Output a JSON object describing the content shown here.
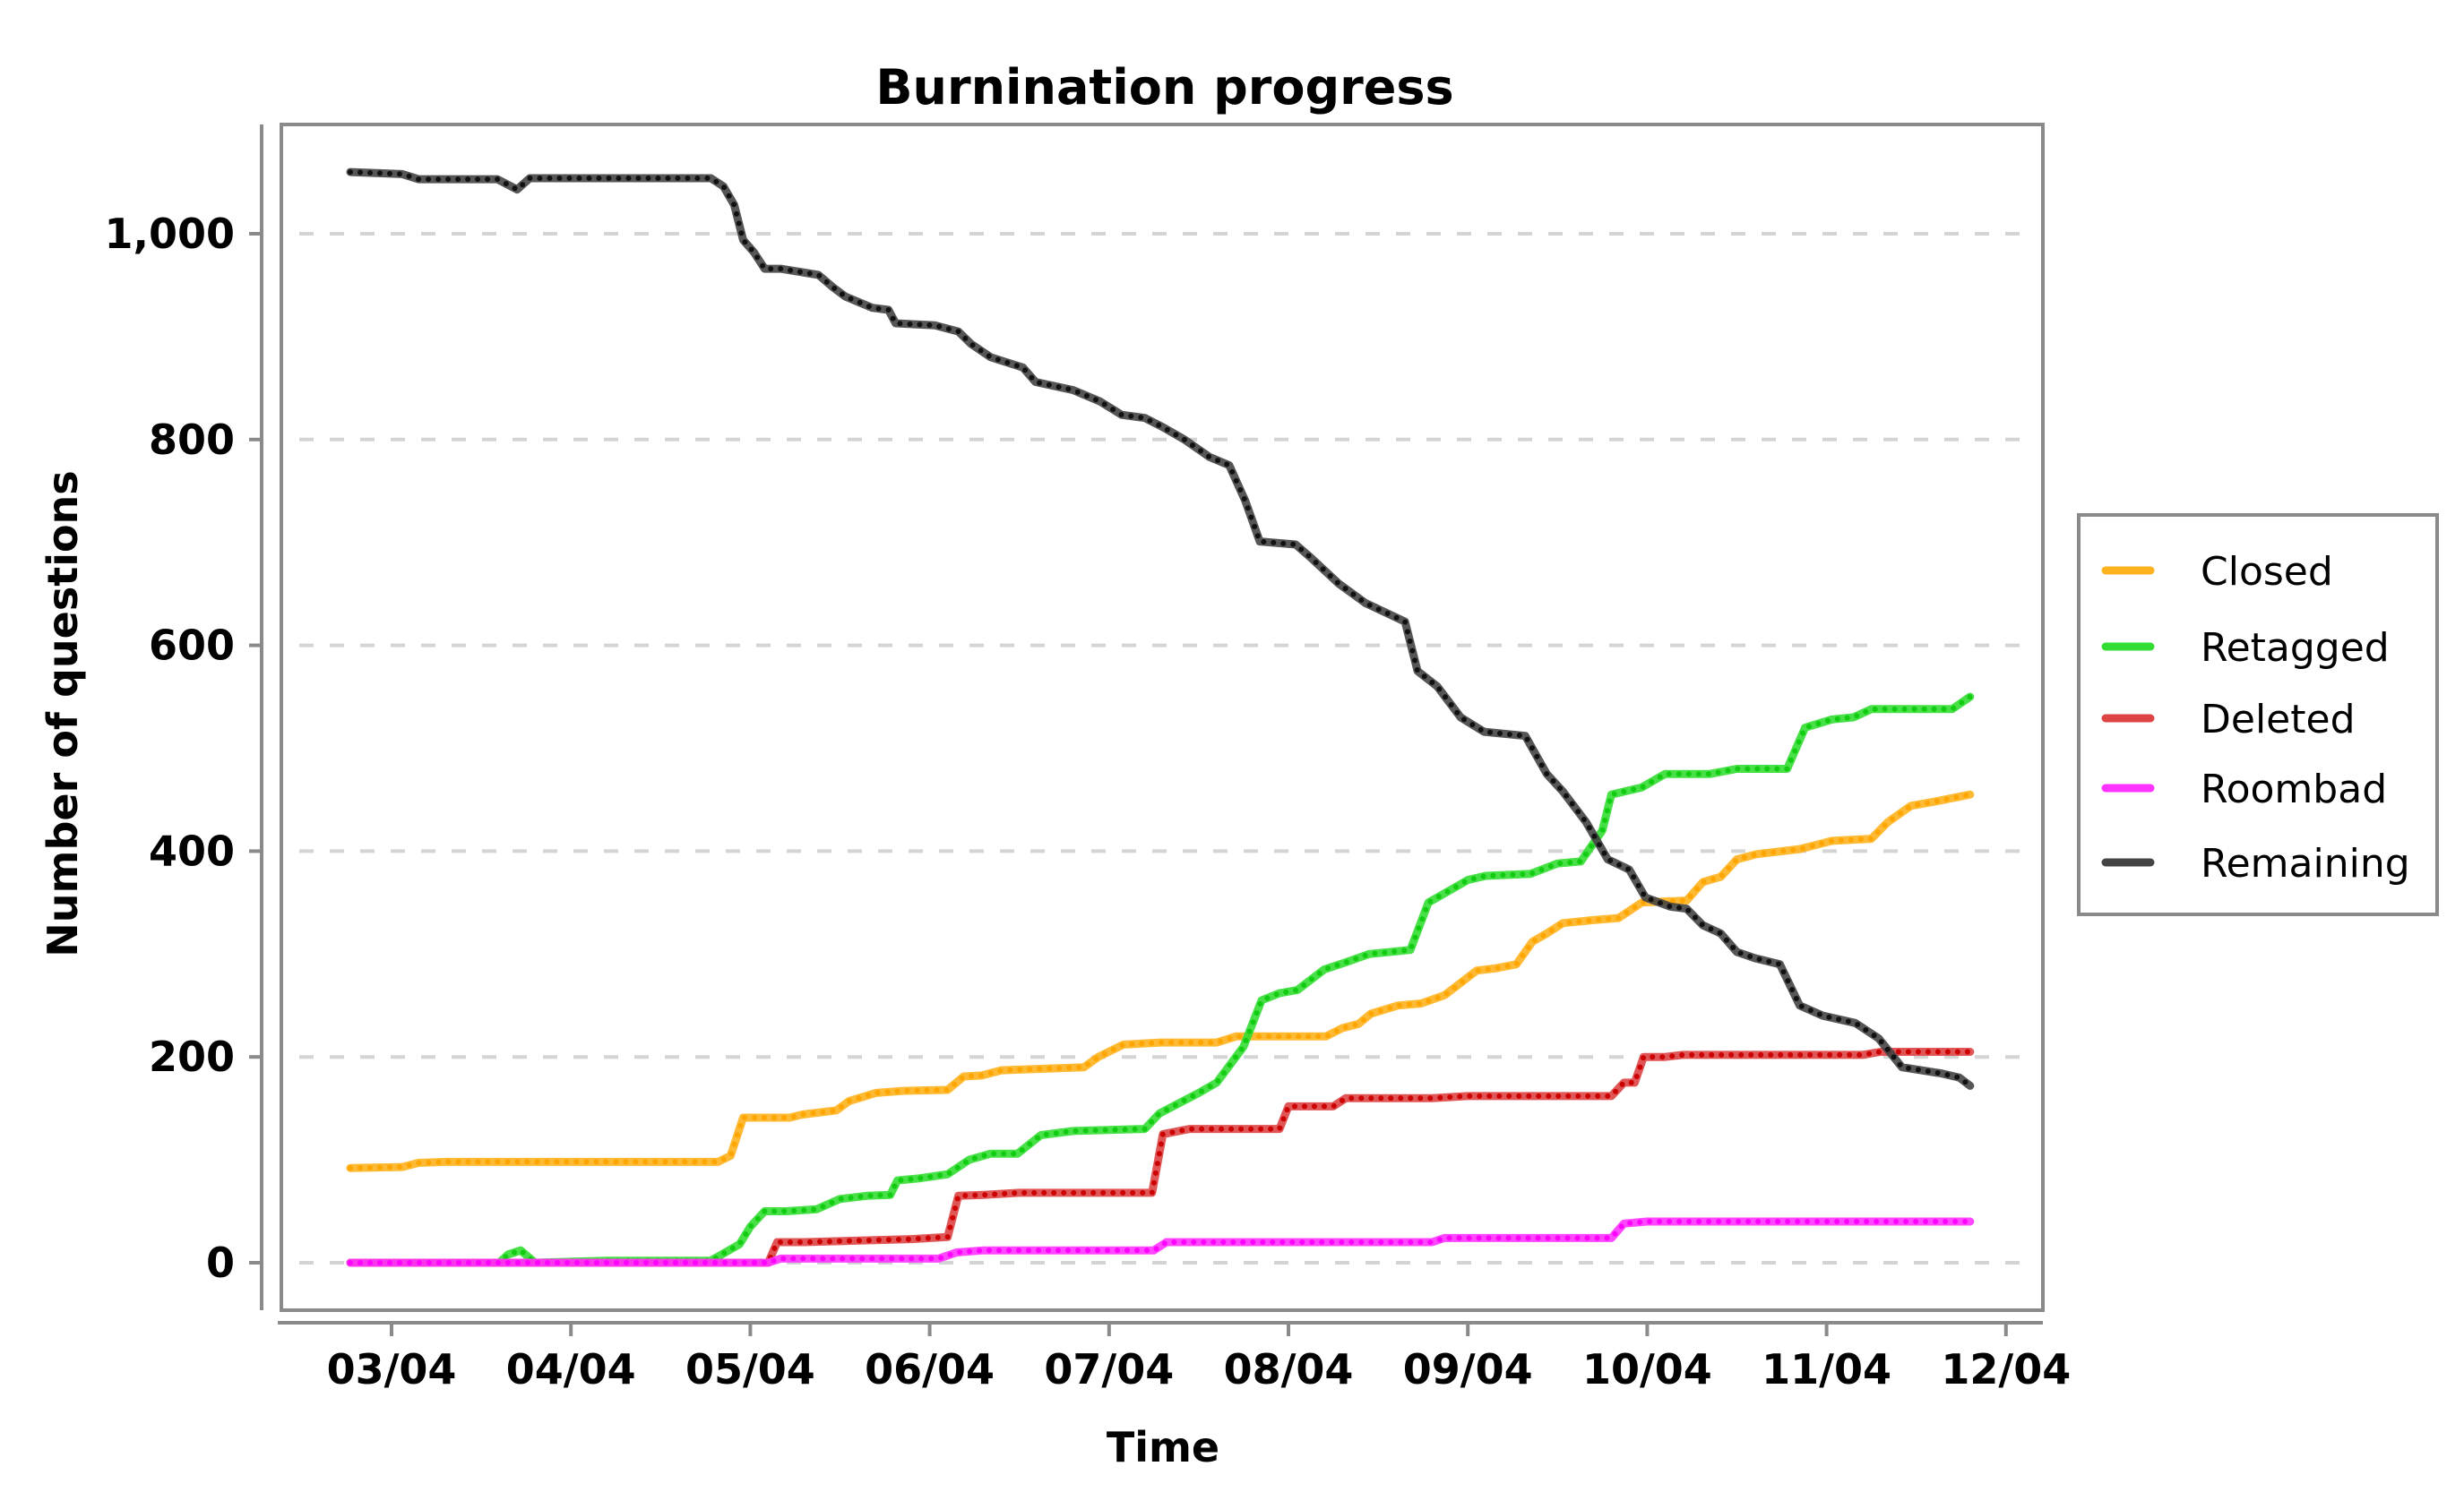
{
  "chart_data": {
    "type": "line",
    "title": "Burnination progress",
    "xlabel": "Time",
    "ylabel": "Number of questions",
    "x_unit": "day of April",
    "xlim": [
      2.3,
      12.1
    ],
    "ylim": [
      -70,
      1100
    ],
    "x_ticks": [
      {
        "value": 3,
        "label": "03/04"
      },
      {
        "value": 4,
        "label": "04/04"
      },
      {
        "value": 5,
        "label": "05/04"
      },
      {
        "value": 6,
        "label": "06/04"
      },
      {
        "value": 7,
        "label": "07/04"
      },
      {
        "value": 8,
        "label": "08/04"
      },
      {
        "value": 9,
        "label": "09/04"
      },
      {
        "value": 10,
        "label": "10/04"
      },
      {
        "value": 11,
        "label": "11/04"
      },
      {
        "value": 12,
        "label": "12/04"
      }
    ],
    "y_ticks": [
      {
        "value": 0,
        "label": "0"
      },
      {
        "value": 200,
        "label": "200"
      },
      {
        "value": 400,
        "label": "400"
      },
      {
        "value": 600,
        "label": "600"
      },
      {
        "value": 800,
        "label": "800"
      },
      {
        "value": 1000,
        "label": "1,000"
      }
    ],
    "grid": "horizontal-dashed",
    "legend_position": "right",
    "series": [
      {
        "name": "Closed",
        "color": "#ffb21f",
        "dot_color": "#ffa500",
        "points": [
          [
            2.77,
            92
          ],
          [
            3.06,
            93
          ],
          [
            3.15,
            97
          ],
          [
            3.3,
            98
          ],
          [
            4.82,
            98
          ],
          [
            4.89,
            104
          ],
          [
            4.96,
            141
          ],
          [
            5.22,
            141
          ],
          [
            5.29,
            144
          ],
          [
            5.48,
            148
          ],
          [
            5.55,
            157
          ],
          [
            5.7,
            165
          ],
          [
            5.85,
            167
          ],
          [
            6.1,
            168
          ],
          [
            6.19,
            181
          ],
          [
            6.29,
            182
          ],
          [
            6.4,
            187
          ],
          [
            6.55,
            188
          ],
          [
            6.86,
            190
          ],
          [
            6.94,
            200
          ],
          [
            7.08,
            212
          ],
          [
            7.29,
            214
          ],
          [
            7.6,
            214
          ],
          [
            7.71,
            220
          ],
          [
            8.21,
            220
          ],
          [
            8.3,
            228
          ],
          [
            8.39,
            232
          ],
          [
            8.46,
            242
          ],
          [
            8.61,
            250
          ],
          [
            8.74,
            252
          ],
          [
            8.87,
            260
          ],
          [
            8.96,
            272
          ],
          [
            9.05,
            284
          ],
          [
            9.15,
            286
          ],
          [
            9.27,
            290
          ],
          [
            9.36,
            312
          ],
          [
            9.44,
            320
          ],
          [
            9.53,
            330
          ],
          [
            9.7,
            333
          ],
          [
            9.84,
            335
          ],
          [
            9.97,
            350
          ],
          [
            10.22,
            352
          ],
          [
            10.31,
            370
          ],
          [
            10.41,
            375
          ],
          [
            10.5,
            392
          ],
          [
            10.61,
            397
          ],
          [
            10.85,
            402
          ],
          [
            11.03,
            410
          ],
          [
            11.25,
            412
          ],
          [
            11.34,
            428
          ],
          [
            11.47,
            444
          ],
          [
            11.6,
            448
          ],
          [
            11.8,
            455
          ]
        ]
      },
      {
        "name": "Retagged",
        "color": "#33dd33",
        "dot_color": "#11cc11",
        "points": [
          [
            2.77,
            0
          ],
          [
            3.6,
            0
          ],
          [
            3.65,
            8
          ],
          [
            3.72,
            12
          ],
          [
            3.8,
            0
          ],
          [
            4.2,
            2
          ],
          [
            4.78,
            2
          ],
          [
            4.86,
            10
          ],
          [
            4.94,
            18
          ],
          [
            5.0,
            35
          ],
          [
            5.08,
            50
          ],
          [
            5.2,
            50
          ],
          [
            5.37,
            52
          ],
          [
            5.5,
            62
          ],
          [
            5.65,
            65
          ],
          [
            5.78,
            66
          ],
          [
            5.82,
            80
          ],
          [
            5.94,
            82
          ],
          [
            6.1,
            86
          ],
          [
            6.22,
            100
          ],
          [
            6.34,
            106
          ],
          [
            6.49,
            106
          ],
          [
            6.62,
            124
          ],
          [
            6.8,
            128
          ],
          [
            7.2,
            130
          ],
          [
            7.28,
            145
          ],
          [
            7.5,
            165
          ],
          [
            7.6,
            175
          ],
          [
            7.75,
            210
          ],
          [
            7.85,
            255
          ],
          [
            7.95,
            262
          ],
          [
            8.05,
            265
          ],
          [
            8.2,
            285
          ],
          [
            8.32,
            292
          ],
          [
            8.45,
            300
          ],
          [
            8.68,
            304
          ],
          [
            8.78,
            350
          ],
          [
            8.9,
            362
          ],
          [
            9.0,
            372
          ],
          [
            9.1,
            376
          ],
          [
            9.35,
            378
          ],
          [
            9.5,
            388
          ],
          [
            9.63,
            390
          ],
          [
            9.75,
            420
          ],
          [
            9.8,
            455
          ],
          [
            9.97,
            462
          ],
          [
            10.1,
            475
          ],
          [
            10.35,
            475
          ],
          [
            10.5,
            480
          ],
          [
            10.78,
            480
          ],
          [
            10.88,
            520
          ],
          [
            11.03,
            528
          ],
          [
            11.15,
            530
          ],
          [
            11.25,
            538
          ],
          [
            11.7,
            538
          ],
          [
            11.8,
            550
          ]
        ]
      },
      {
        "name": "Deleted",
        "color": "#dd4444",
        "dot_color": "#cc0000",
        "points": [
          [
            2.77,
            0
          ],
          [
            5.1,
            0
          ],
          [
            5.15,
            20
          ],
          [
            5.3,
            20
          ],
          [
            5.5,
            21
          ],
          [
            5.9,
            23
          ],
          [
            6.1,
            25
          ],
          [
            6.16,
            65
          ],
          [
            6.3,
            66
          ],
          [
            6.5,
            68
          ],
          [
            7.24,
            68
          ],
          [
            7.3,
            125
          ],
          [
            7.45,
            130
          ],
          [
            7.95,
            130
          ],
          [
            8.0,
            152
          ],
          [
            8.25,
            152
          ],
          [
            8.32,
            160
          ],
          [
            8.8,
            160
          ],
          [
            9.0,
            162
          ],
          [
            9.8,
            162
          ],
          [
            9.87,
            175
          ],
          [
            9.93,
            175
          ],
          [
            9.98,
            200
          ],
          [
            10.1,
            200
          ],
          [
            10.2,
            202
          ],
          [
            11.2,
            202
          ],
          [
            11.3,
            205
          ],
          [
            11.8,
            205
          ]
        ]
      },
      {
        "name": "Roombad",
        "color": "#ff33ff",
        "dot_color": "#ff00ff",
        "points": [
          [
            2.77,
            0
          ],
          [
            5.1,
            0
          ],
          [
            5.17,
            4
          ],
          [
            6.05,
            4
          ],
          [
            6.15,
            10
          ],
          [
            6.3,
            12
          ],
          [
            7.25,
            12
          ],
          [
            7.32,
            20
          ],
          [
            8.1,
            20
          ],
          [
            8.8,
            20
          ],
          [
            8.87,
            24
          ],
          [
            9.8,
            24
          ],
          [
            9.87,
            38
          ],
          [
            10.0,
            40
          ],
          [
            11.8,
            40
          ]
        ]
      },
      {
        "name": "Remaining",
        "color": "#444444",
        "dot_color": "#111111",
        "points": [
          [
            2.77,
            1060
          ],
          [
            3.06,
            1058
          ],
          [
            3.15,
            1053
          ],
          [
            3.59,
            1053
          ],
          [
            3.7,
            1043
          ],
          [
            3.77,
            1054
          ],
          [
            4.78,
            1054
          ],
          [
            4.85,
            1046
          ],
          [
            4.91,
            1028
          ],
          [
            4.96,
            994
          ],
          [
            5.02,
            982
          ],
          [
            5.08,
            966
          ],
          [
            5.17,
            966
          ],
          [
            5.38,
            960
          ],
          [
            5.46,
            948
          ],
          [
            5.53,
            939
          ],
          [
            5.68,
            928
          ],
          [
            5.77,
            926
          ],
          [
            5.81,
            913
          ],
          [
            6.03,
            911
          ],
          [
            6.16,
            905
          ],
          [
            6.23,
            893
          ],
          [
            6.34,
            880
          ],
          [
            6.52,
            870
          ],
          [
            6.59,
            856
          ],
          [
            6.8,
            848
          ],
          [
            6.95,
            837
          ],
          [
            7.07,
            824
          ],
          [
            7.2,
            821
          ],
          [
            7.3,
            812
          ],
          [
            7.42,
            800
          ],
          [
            7.56,
            783
          ],
          [
            7.67,
            775
          ],
          [
            7.76,
            740
          ],
          [
            7.84,
            701
          ],
          [
            8.04,
            698
          ],
          [
            8.12,
            686
          ],
          [
            8.28,
            660
          ],
          [
            8.43,
            641
          ],
          [
            8.65,
            623
          ],
          [
            8.72,
            575
          ],
          [
            8.83,
            560
          ],
          [
            8.96,
            530
          ],
          [
            9.09,
            516
          ],
          [
            9.32,
            512
          ],
          [
            9.44,
            475
          ],
          [
            9.53,
            458
          ],
          [
            9.66,
            428
          ],
          [
            9.78,
            392
          ],
          [
            9.9,
            382
          ],
          [
            9.99,
            355
          ],
          [
            10.13,
            346
          ],
          [
            10.22,
            344
          ],
          [
            10.31,
            328
          ],
          [
            10.41,
            320
          ],
          [
            10.5,
            302
          ],
          [
            10.6,
            296
          ],
          [
            10.74,
            290
          ],
          [
            10.85,
            250
          ],
          [
            10.98,
            240
          ],
          [
            11.16,
            233
          ],
          [
            11.29,
            218
          ],
          [
            11.42,
            190
          ],
          [
            11.64,
            184
          ],
          [
            11.74,
            180
          ],
          [
            11.8,
            172
          ]
        ]
      }
    ]
  }
}
